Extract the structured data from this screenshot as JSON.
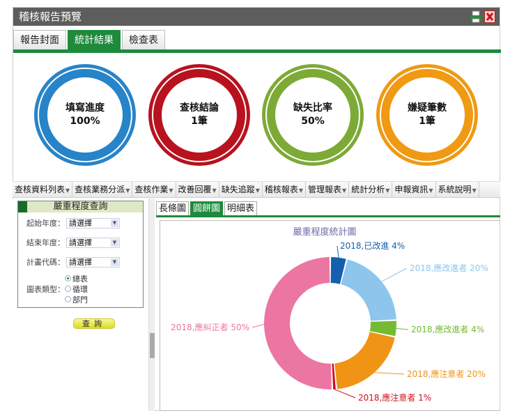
{
  "window": {
    "title": "稽核報告預覽",
    "icons": [
      "printer-icon",
      "close-icon"
    ]
  },
  "tabs": [
    {
      "label": "報告封面",
      "active": false
    },
    {
      "label": "統計結果",
      "active": true
    },
    {
      "label": "檢查表",
      "active": false
    }
  ],
  "stats": [
    {
      "label": "填寫進度",
      "value": "100%",
      "color": "#2784c8"
    },
    {
      "label": "查核結論",
      "value": "1筆",
      "color": "#b8121e"
    },
    {
      "label": "缺失比率",
      "value": "50%",
      "color": "#7daa36"
    },
    {
      "label": "嫌疑筆數",
      "value": "1筆",
      "color": "#ef9a12"
    }
  ],
  "menu": [
    "查核資料列表",
    "查核業務分派",
    "查核作業",
    "改善回覆",
    "缺失追蹤",
    "稽核報表",
    "管理報表",
    "統計分析",
    "申報資訊",
    "系統說明"
  ],
  "query": {
    "title": "嚴重程度查詢",
    "fields": [
      {
        "label": "起始年度：",
        "value": "請選擇"
      },
      {
        "label": "結束年度：",
        "value": "請選擇"
      },
      {
        "label": "計畫代碼：",
        "value": "請選擇"
      }
    ],
    "chart_type_label": "圖表類型：",
    "chart_types": [
      {
        "label": "總表",
        "checked": true
      },
      {
        "label": "循環",
        "checked": false
      },
      {
        "label": "部門",
        "checked": false
      }
    ],
    "submit": "查詢"
  },
  "chart_tabs": [
    {
      "label": "長條圖",
      "active": false
    },
    {
      "label": "圓餅圖",
      "active": true
    },
    {
      "label": "明細表",
      "active": false
    }
  ],
  "chart_data": {
    "type": "pie",
    "donut": true,
    "title": "嚴重程度統計圖",
    "slices": [
      {
        "label": "2018,已改進 4%",
        "value": 4,
        "color": "#1460ad"
      },
      {
        "label": "2018,應改進者 20%",
        "value": 20,
        "color": "#8ec5ec"
      },
      {
        "label": "2018,應改進者 4%",
        "value": 4,
        "color": "#74bb33"
      },
      {
        "label": "2018,應注意者 20%",
        "value": 20,
        "color": "#ef9415"
      },
      {
        "label": "2018,應注意者 1%",
        "value": 1,
        "color": "#cc1020"
      },
      {
        "label": "2018,應糾正者 50%",
        "value": 50,
        "color": "#ec76a2"
      }
    ]
  }
}
